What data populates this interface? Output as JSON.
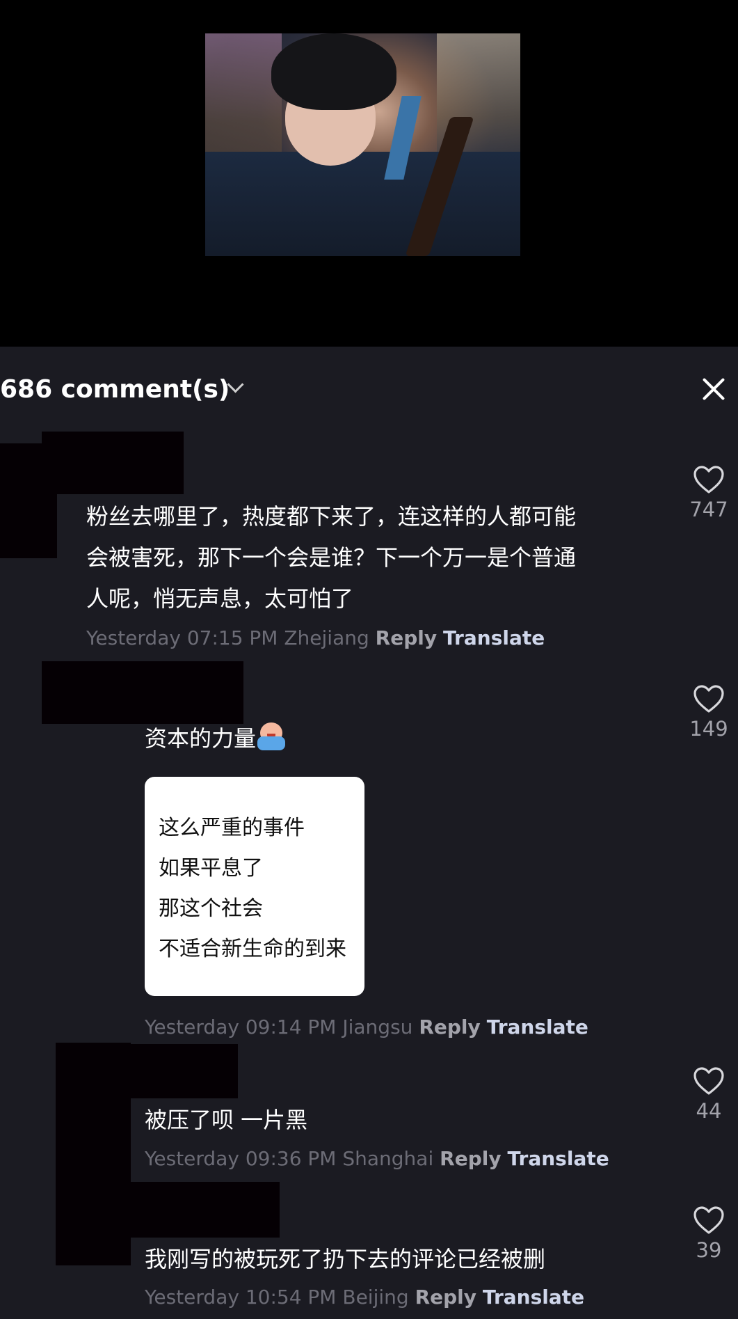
{
  "header": {
    "comment_count": "686 comment(s)"
  },
  "comments": [
    {
      "text_lines": [
        "粉丝去哪里了，热度都下来了，连这样的人都可能",
        "会被害死，那下一个会是谁？下一个万一是个普通",
        "人呢，悄无声息，太可怕了"
      ],
      "time": "Yesterday 07:15 PM Zhejiang",
      "reply": "Reply",
      "translate": "Translate",
      "likes": "747"
    },
    {
      "text": "资本的力量",
      "emoji": "crying-face-emoji",
      "card_lines": [
        "这么严重的事件",
        "如果平息了",
        "那这个社会",
        "不适合新生命的到来"
      ],
      "time": "Yesterday 09:14 PM Jiangsu",
      "reply": "Reply",
      "translate": "Translate",
      "likes": "149"
    },
    {
      "text": "被压了呗 一片黑",
      "time": "Yesterday 09:36 PM Shanghai",
      "reply": "Reply",
      "translate": "Translate",
      "likes": "44"
    },
    {
      "text": "我刚写的被玩死了扔下去的评论已经被删",
      "time": "Yesterday 10:54 PM Beijing",
      "reply": "Reply",
      "translate": "Translate",
      "likes": "39"
    }
  ],
  "colors": {
    "background": "#1b1b22",
    "meta_time": "#6c6c76",
    "reply": "#a3a3ab",
    "translate": "#cfd6ea"
  }
}
